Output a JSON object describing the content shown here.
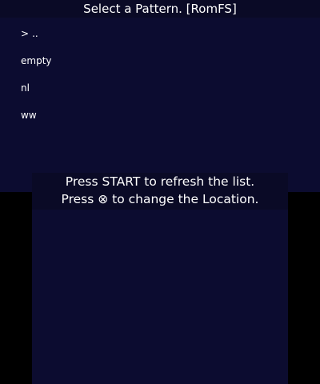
{
  "header": {
    "title": "Select a Pattern. [RomFS]"
  },
  "file_list": {
    "cursor": ">",
    "items": [
      {
        "label": "..",
        "selected": true
      },
      {
        "label": "empty",
        "selected": false
      },
      {
        "label": "nl",
        "selected": false
      },
      {
        "label": "ww",
        "selected": false
      }
    ]
  },
  "info": {
    "line1": "Press START to refresh the list.",
    "line2": "Press ⊗ to change the Location."
  },
  "colors": {
    "screen_bg": "#0c0c30",
    "bar_bg": "#0a0a26",
    "outer_bg": "#000000",
    "text": "#ffffff"
  }
}
